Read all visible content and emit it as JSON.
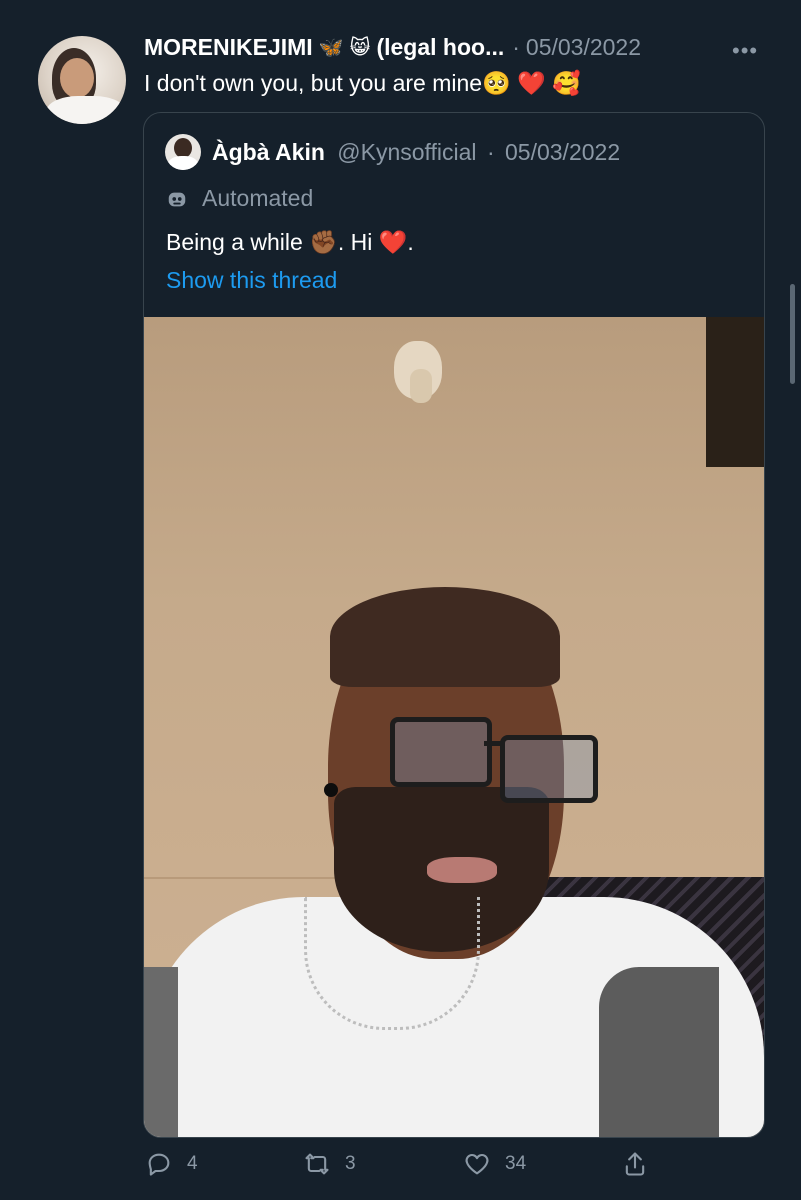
{
  "tweet": {
    "display_name": "MORENIKEJIMI",
    "display_name_emojis": [
      "🦋",
      "😸"
    ],
    "display_name_suffix": "(legal hoo...",
    "timestamp_sep": "·",
    "timestamp": "05/03/2022",
    "more_icon": "more-horizontal-icon",
    "text": "I don't own you, but you are mine🥺 ❤️ 🥰"
  },
  "quote": {
    "name": "Àgbà Akin",
    "handle": "@Kynsofficial",
    "timestamp_sep": "·",
    "timestamp": "05/03/2022",
    "automated_label": "Automated",
    "text": "Being a while ✊🏾. Hi ❤️.",
    "show_thread": "Show this thread"
  },
  "actions": {
    "reply_count": "4",
    "retweet_count": "3",
    "like_count": "34"
  },
  "colors": {
    "background": "#15202b",
    "muted": "#8b98a5",
    "link": "#1d9bf0",
    "border": "#38444d"
  }
}
